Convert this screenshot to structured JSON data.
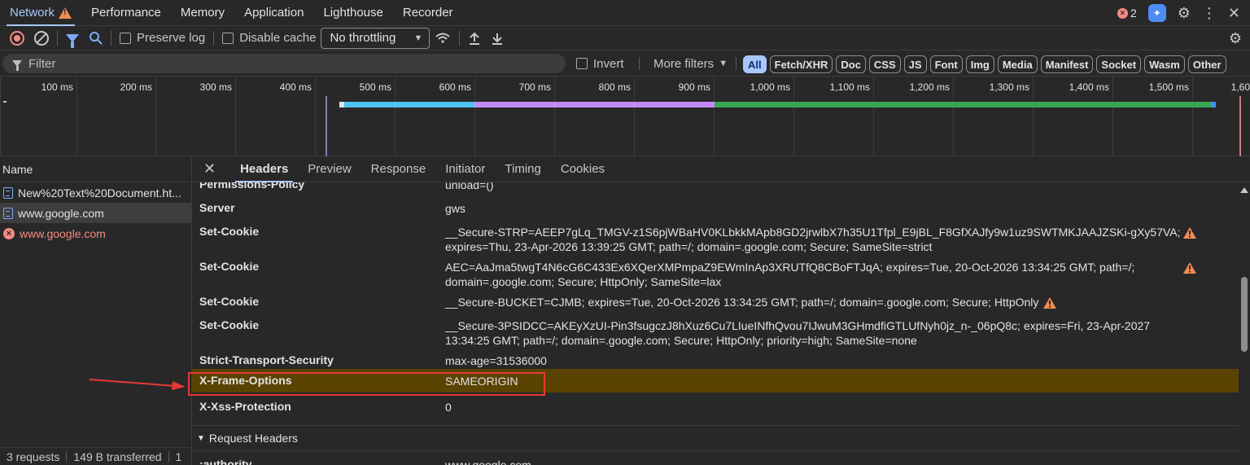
{
  "devtools_tabs": [
    {
      "label": "Network",
      "active": true,
      "warning": true
    },
    {
      "label": "Performance"
    },
    {
      "label": "Memory"
    },
    {
      "label": "Application"
    },
    {
      "label": "Lighthouse"
    },
    {
      "label": "Recorder"
    }
  ],
  "top_right": {
    "error_count": "2",
    "icons": [
      "ai-assistant-icon",
      "gear-icon",
      "kebab-menu-icon",
      "close-icon"
    ]
  },
  "toolbar": {
    "preserve_log": "Preserve log",
    "disable_cache": "Disable cache",
    "throttling": "No throttling",
    "icons": [
      "record-icon",
      "clear-icon",
      "filter-icon",
      "search-icon",
      "network-conditions-icon",
      "import-icon",
      "export-icon",
      "settings-icon"
    ]
  },
  "filter": {
    "placeholder": "Filter",
    "invert": "Invert",
    "more_filters": "More filters",
    "chips": [
      "All",
      "Fetch/XHR",
      "Doc",
      "CSS",
      "JS",
      "Font",
      "Img",
      "Media",
      "Manifest",
      "Socket",
      "Wasm",
      "Other"
    ]
  },
  "timeline": {
    "ticks": [
      "100 ms",
      "200 ms",
      "300 ms",
      "400 ms",
      "500 ms",
      "600 ms",
      "700 ms",
      "800 ms",
      "900 ms",
      "1,000 ms",
      "1,100 ms",
      "1,200 ms",
      "1,300 ms",
      "1,400 ms",
      "1,500 ms",
      "1,60"
    ]
  },
  "request_list": {
    "header": "Name",
    "rows": [
      {
        "name": "New%20Text%20Document.ht...",
        "type": "doc"
      },
      {
        "name": "www.google.com",
        "type": "doc",
        "selected": true
      },
      {
        "name": "www.google.com",
        "type": "error"
      }
    ],
    "status": {
      "requests": "3 requests",
      "transferred": "149 B transferred",
      "extra": "1"
    }
  },
  "detail_tabs": [
    "Headers",
    "Preview",
    "Response",
    "Initiator",
    "Timing",
    "Cookies"
  ],
  "response_headers": [
    {
      "name": "Permissions-Policy",
      "value": "unload=()"
    },
    {
      "name": "Server",
      "value": "gws"
    },
    {
      "name": "Set-Cookie",
      "value": "__Secure-STRP=AEEP7gLq_TMGV-z1S6pjWBaHV0KLbkkMApb8GD2jrwlbX7h35U1Tfpl_E9jBL_F8GfXAJfy9w1uz9SWTMKJAAJZSKi-gXy57VA; expires=Thu, 23-Apr-2026 13:39:25 GMT; path=/; domain=.google.com; Secure; SameSite=strict",
      "warning": true
    },
    {
      "name": "Set-Cookie",
      "value": "AEC=AaJma5twgT4N6cG6C433Ex6XQerXMPmpaZ9EWmInAp3XRUTfQ8CBoFTJqA; expires=Tue, 20-Oct-2026 13:34:25 GMT; path=/; domain=.google.com; Secure; HttpOnly; SameSite=lax",
      "warning": true
    },
    {
      "name": "Set-Cookie",
      "value": "__Secure-BUCKET=CJMB; expires=Tue, 20-Oct-2026 13:34:25 GMT; path=/; domain=.google.com; Secure; HttpOnly",
      "warning": true
    },
    {
      "name": "Set-Cookie",
      "value": "__Secure-3PSIDCC=AKEyXzUI-Pin3fsugczJ8hXuz6Cu7LIueINfhQvou7IJwuM3GHmdfiGTLUfNyh0jz_n-_06pQ8c; expires=Fri, 23-Apr-2027 13:34:25 GMT; path=/; domain=.google.com; Secure; HttpOnly; priority=high; SameSite=none"
    },
    {
      "name": "Strict-Transport-Security",
      "value": "max-age=31536000"
    },
    {
      "name": "X-Frame-Options",
      "value": "SAMEORIGIN",
      "highlighted": true
    },
    {
      "name": "X-Xss-Protection",
      "value": "0"
    }
  ],
  "request_headers": {
    "title": "Request Headers",
    "first": {
      "name": ":authority",
      "value": "www.google.com"
    }
  },
  "colors": {
    "accent": "#a8c7fa",
    "highlight": "#5b4304",
    "annotation": "#e53935",
    "warning": "#f28b54",
    "error": "#f28b82"
  }
}
